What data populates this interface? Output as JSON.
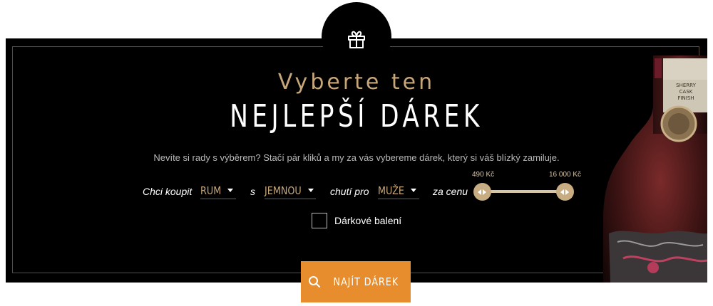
{
  "hero": {
    "subtitle": "Vyberte ten",
    "title": "NEJLEPŠÍ DÁREK",
    "lead": "Nevíte si rady s výběrem? Stačí pár kliků a my za vás vybereme dárek, který si váš blízký zamiluje."
  },
  "filter": {
    "label_buy": "Chci koupit",
    "category_value": "RUM",
    "label_with": "s",
    "taste_value": "JEMNOU",
    "label_taste_for": "chutí pro",
    "recipient_value": "MUŽE",
    "label_price": "za cenu",
    "price_min_label": "490 Kč",
    "price_max_label": "16 000 Kč",
    "price_range_selected_fraction": [
      0,
      1
    ]
  },
  "gift_wrap": {
    "label": "Dárkové balení",
    "checked": false
  },
  "search_button": {
    "label": "NAJÍT DÁREK"
  },
  "bottle_label_text": [
    "SHERRY",
    "CASK",
    "FINISH"
  ],
  "colors": {
    "background": "#000000",
    "accent_gold": "#c7a77a",
    "button_orange": "#e88d2d"
  },
  "icons": {
    "badge": "gift-icon",
    "button": "search-icon"
  }
}
